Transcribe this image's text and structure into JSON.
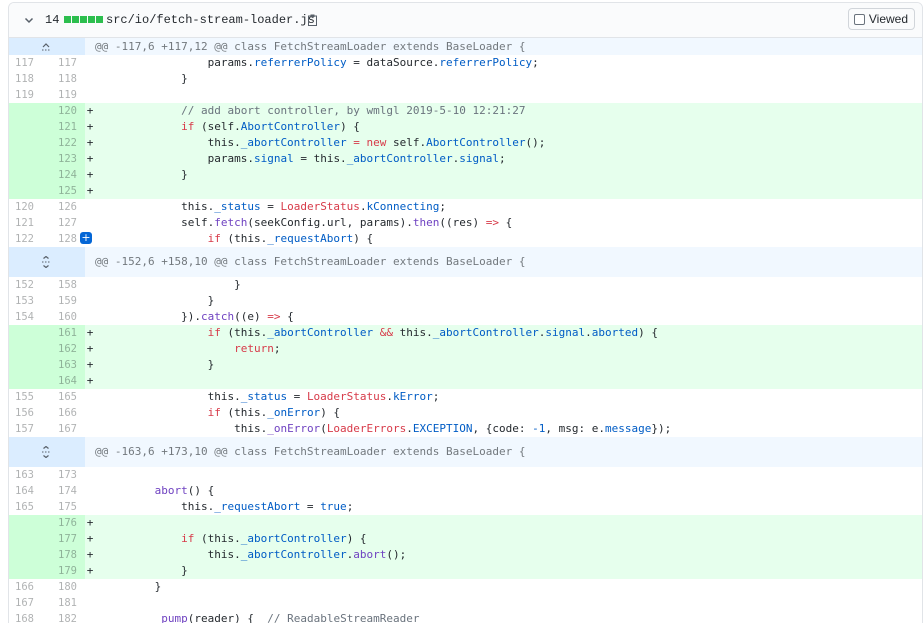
{
  "file": {
    "change_count": "14",
    "path": "src/io/fetch-stream-loader.js",
    "viewed_label": "Viewed",
    "bar_color": "#2cbe4e"
  },
  "hunks": [
    {
      "header": "@@ -117,6 +117,12 @@ class FetchStreamLoader extends BaseLoader {",
      "rows": [
        {
          "type": "ctx",
          "old": "117",
          "new": "117",
          "code": [
            {
              "t": "                params."
            },
            {
              "t": "referrerPolicy",
              "c": "prop"
            },
            {
              "t": " = dataSource."
            },
            {
              "t": "referrerPolicy",
              "c": "prop"
            },
            {
              "t": ";"
            }
          ]
        },
        {
          "type": "ctx",
          "old": "118",
          "new": "118",
          "code": [
            {
              "t": "            }"
            }
          ]
        },
        {
          "type": "ctx",
          "old": "119",
          "new": "119",
          "code": [
            {
              "t": ""
            }
          ]
        },
        {
          "type": "add",
          "old": "",
          "new": "120",
          "code": [
            {
              "t": "            "
            },
            {
              "t": "// add abort controller, by wmlgl 2019-5-10 12:21:27",
              "c": "cmt"
            }
          ]
        },
        {
          "type": "add",
          "old": "",
          "new": "121",
          "code": [
            {
              "t": "            "
            },
            {
              "t": "if",
              "c": "kw"
            },
            {
              "t": " (self."
            },
            {
              "t": "AbortController",
              "c": "prop"
            },
            {
              "t": ") {"
            }
          ]
        },
        {
          "type": "add",
          "old": "",
          "new": "122",
          "code": [
            {
              "t": "                this."
            },
            {
              "t": "_abortController",
              "c": "prop"
            },
            {
              "t": " = ",
              "c": "kw"
            },
            {
              "t": "new",
              "c": "kw"
            },
            {
              "t": " self."
            },
            {
              "t": "AbortController",
              "c": "prop"
            },
            {
              "t": "();"
            }
          ]
        },
        {
          "type": "add",
          "old": "",
          "new": "123",
          "code": [
            {
              "t": "                params."
            },
            {
              "t": "signal",
              "c": "prop"
            },
            {
              "t": " = this."
            },
            {
              "t": "_abortController",
              "c": "prop"
            },
            {
              "t": "."
            },
            {
              "t": "signal",
              "c": "prop"
            },
            {
              "t": ";"
            }
          ]
        },
        {
          "type": "add",
          "old": "",
          "new": "124",
          "code": [
            {
              "t": "            }"
            }
          ]
        },
        {
          "type": "add",
          "old": "",
          "new": "125",
          "code": [
            {
              "t": ""
            }
          ]
        },
        {
          "type": "ctx",
          "old": "120",
          "new": "126",
          "code": [
            {
              "t": "            this."
            },
            {
              "t": "_status",
              "c": "prop"
            },
            {
              "t": " = "
            },
            {
              "t": "LoaderStatus",
              "c": "kw"
            },
            {
              "t": "."
            },
            {
              "t": "kConnecting",
              "c": "prop"
            },
            {
              "t": ";"
            }
          ]
        },
        {
          "type": "ctx",
          "old": "121",
          "new": "127",
          "code": [
            {
              "t": "            self."
            },
            {
              "t": "fetch",
              "c": "fn"
            },
            {
              "t": "(seekConfig.url, params)."
            },
            {
              "t": "then",
              "c": "fn"
            },
            {
              "t": "((res) "
            },
            {
              "t": "=>",
              "c": "kw"
            },
            {
              "t": " {"
            }
          ]
        },
        {
          "type": "ctx",
          "old": "122",
          "new": "128",
          "plus": true,
          "code": [
            {
              "t": "                "
            },
            {
              "t": "if",
              "c": "kw"
            },
            {
              "t": " (this."
            },
            {
              "t": "_requestAbort",
              "c": "prop"
            },
            {
              "t": ") {"
            }
          ]
        }
      ]
    },
    {
      "header": "@@ -152,6 +158,10 @@ class FetchStreamLoader extends BaseLoader {",
      "rows": [
        {
          "type": "ctx",
          "old": "152",
          "new": "158",
          "code": [
            {
              "t": "                    }"
            }
          ]
        },
        {
          "type": "ctx",
          "old": "153",
          "new": "159",
          "code": [
            {
              "t": "                }"
            }
          ]
        },
        {
          "type": "ctx",
          "old": "154",
          "new": "160",
          "code": [
            {
              "t": "            })."
            },
            {
              "t": "catch",
              "c": "fn"
            },
            {
              "t": "((e) "
            },
            {
              "t": "=>",
              "c": "kw"
            },
            {
              "t": " {"
            }
          ]
        },
        {
          "type": "add",
          "old": "",
          "new": "161",
          "code": [
            {
              "t": "                "
            },
            {
              "t": "if",
              "c": "kw"
            },
            {
              "t": " (this."
            },
            {
              "t": "_abortController",
              "c": "prop"
            },
            {
              "t": " "
            },
            {
              "t": "&&",
              "c": "kw"
            },
            {
              "t": " this."
            },
            {
              "t": "_abortController",
              "c": "prop"
            },
            {
              "t": "."
            },
            {
              "t": "signal",
              "c": "prop"
            },
            {
              "t": "."
            },
            {
              "t": "aborted",
              "c": "prop"
            },
            {
              "t": ") {"
            }
          ]
        },
        {
          "type": "add",
          "old": "",
          "new": "162",
          "code": [
            {
              "t": "                    "
            },
            {
              "t": "return",
              "c": "kw"
            },
            {
              "t": ";"
            }
          ]
        },
        {
          "type": "add",
          "old": "",
          "new": "163",
          "code": [
            {
              "t": "                }"
            }
          ]
        },
        {
          "type": "add",
          "old": "",
          "new": "164",
          "code": [
            {
              "t": ""
            }
          ]
        },
        {
          "type": "ctx",
          "old": "155",
          "new": "165",
          "code": [
            {
              "t": "                this."
            },
            {
              "t": "_status",
              "c": "prop"
            },
            {
              "t": " = "
            },
            {
              "t": "LoaderStatus",
              "c": "kw"
            },
            {
              "t": "."
            },
            {
              "t": "kError",
              "c": "prop"
            },
            {
              "t": ";"
            }
          ]
        },
        {
          "type": "ctx",
          "old": "156",
          "new": "166",
          "code": [
            {
              "t": "                "
            },
            {
              "t": "if",
              "c": "kw"
            },
            {
              "t": " (this."
            },
            {
              "t": "_onError",
              "c": "prop"
            },
            {
              "t": ") {"
            }
          ]
        },
        {
          "type": "ctx",
          "old": "157",
          "new": "167",
          "code": [
            {
              "t": "                    this."
            },
            {
              "t": "_onError",
              "c": "fn"
            },
            {
              "t": "("
            },
            {
              "t": "LoaderErrors",
              "c": "kw"
            },
            {
              "t": "."
            },
            {
              "t": "EXCEPTION",
              "c": "prop"
            },
            {
              "t": ", {code: "
            },
            {
              "t": "-1",
              "c": "prop"
            },
            {
              "t": ", msg: e."
            },
            {
              "t": "message",
              "c": "prop"
            },
            {
              "t": "});"
            }
          ]
        }
      ]
    },
    {
      "header": "@@ -163,6 +173,10 @@ class FetchStreamLoader extends BaseLoader {",
      "rows": [
        {
          "type": "ctx",
          "old": "163",
          "new": "173",
          "code": [
            {
              "t": ""
            }
          ]
        },
        {
          "type": "ctx",
          "old": "164",
          "new": "174",
          "code": [
            {
              "t": "        "
            },
            {
              "t": "abort",
              "c": "fn"
            },
            {
              "t": "() {"
            }
          ]
        },
        {
          "type": "ctx",
          "old": "165",
          "new": "175",
          "code": [
            {
              "t": "            this."
            },
            {
              "t": "_requestAbort",
              "c": "prop"
            },
            {
              "t": " = "
            },
            {
              "t": "true",
              "c": "prop"
            },
            {
              "t": ";"
            }
          ]
        },
        {
          "type": "add",
          "old": "",
          "new": "176",
          "code": [
            {
              "t": ""
            }
          ]
        },
        {
          "type": "add",
          "old": "",
          "new": "177",
          "code": [
            {
              "t": "            "
            },
            {
              "t": "if",
              "c": "kw"
            },
            {
              "t": " (this."
            },
            {
              "t": "_abortController",
              "c": "prop"
            },
            {
              "t": ") {"
            }
          ]
        },
        {
          "type": "add",
          "old": "",
          "new": "178",
          "code": [
            {
              "t": "                this."
            },
            {
              "t": "_abortController",
              "c": "prop"
            },
            {
              "t": "."
            },
            {
              "t": "abort",
              "c": "fn"
            },
            {
              "t": "();"
            }
          ]
        },
        {
          "type": "add",
          "old": "",
          "new": "179",
          "code": [
            {
              "t": "            }"
            }
          ]
        },
        {
          "type": "ctx",
          "old": "166",
          "new": "180",
          "code": [
            {
              "t": "        }"
            }
          ]
        },
        {
          "type": "ctx",
          "old": "167",
          "new": "181",
          "code": [
            {
              "t": ""
            }
          ]
        },
        {
          "type": "ctx",
          "old": "168",
          "new": "182",
          "code": [
            {
              "t": "        "
            },
            {
              "t": "_pump",
              "c": "fn"
            },
            {
              "t": "(reader) {  "
            },
            {
              "t": "// ReadableStreamReader",
              "c": "cmt"
            }
          ]
        }
      ]
    }
  ],
  "icons": {
    "collapse": "chevron-down-icon",
    "copy": "clipboard-icon",
    "expand_up": "fold-up-icon",
    "expand_both": "unfold-icon",
    "add_comment": "plus-icon"
  }
}
